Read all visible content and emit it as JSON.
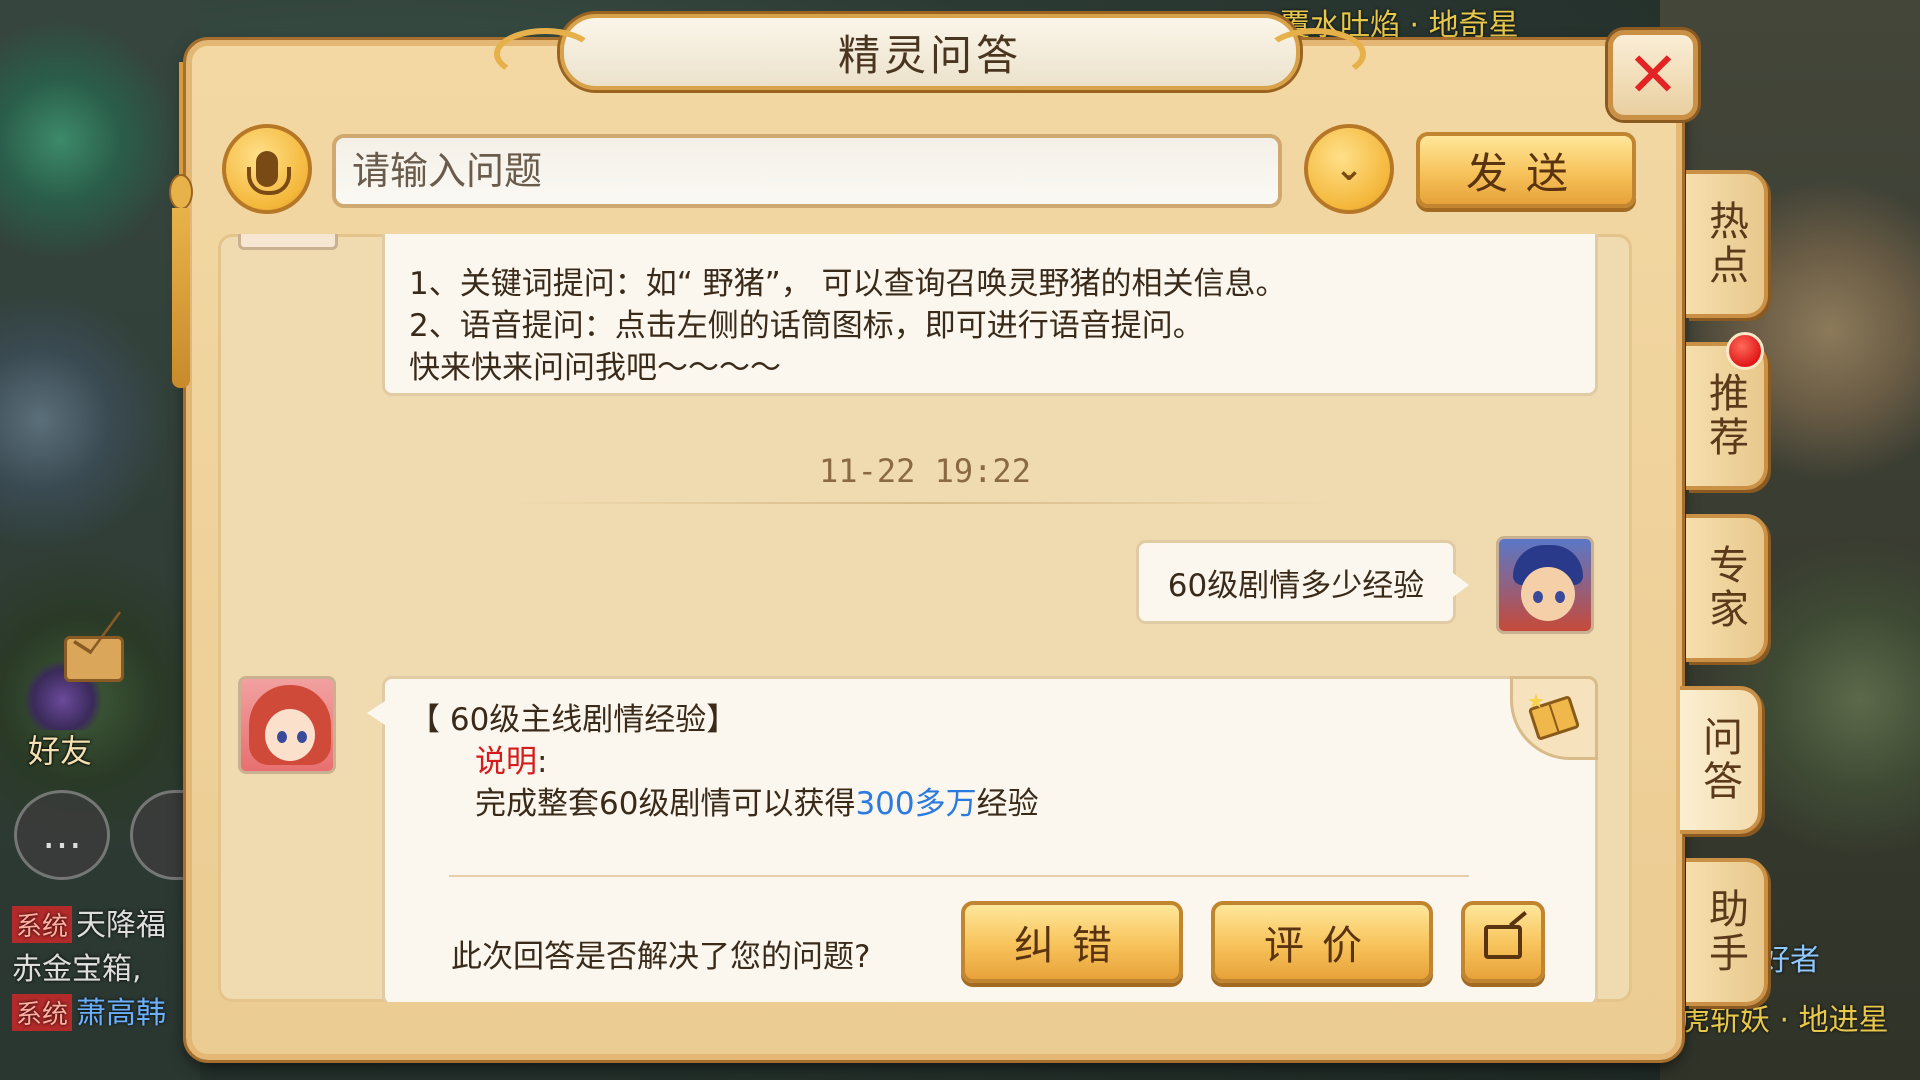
{
  "background": {
    "top_text": "覆水吐焰 · 地奇星",
    "bottom_right_text_1": "好者",
    "bottom_right_text_2": "虎斩妖 · 地进星",
    "friend_label": "好友",
    "system_lines": [
      {
        "tag": "系统",
        "text": "天降福"
      },
      {
        "tag": "",
        "text": "赤金宝箱,"
      },
      {
        "tag": "系统",
        "text": "萧高韩"
      }
    ]
  },
  "dialog": {
    "title": "精灵问答",
    "close_label": "✕"
  },
  "input_row": {
    "placeholder": "请输入问题",
    "dropdown_glyph": "⌄",
    "send_label": "发送"
  },
  "side_tabs": [
    {
      "label": "热点",
      "active": false
    },
    {
      "label": "推荐",
      "active": false,
      "has_notification": true
    },
    {
      "label": "专家",
      "active": false
    },
    {
      "label": "问答",
      "active": true
    },
    {
      "label": "助手",
      "active": false
    }
  ],
  "chat": {
    "intro_lines": [
      "1、关键词提问：如“ 野猪”， 可以查询召唤灵野猪的相关信息。",
      "2、语音提问：点击左侧的话筒图标，即可进行语音提问。",
      "快来快来问问我吧～～～～"
    ],
    "timestamp": "11-22  19:22",
    "user_message": "60级剧情多少经验",
    "answer": {
      "title": "【 60级主线剧情经验】",
      "label": "说明",
      "label_colon": ":",
      "body_prefix": "完成整套60级剧情可以获得",
      "body_highlight": "300多万",
      "body_suffix": "经验",
      "feedback_question": "此次回答是否解决了您的问题?",
      "correct_label": "纠错",
      "rate_label": "评价"
    }
  },
  "colors": {
    "accent_gold": "#f7c25a",
    "close_red": "#e42424",
    "highlight_blue": "#2a7ae0",
    "label_red": "#d41c1c"
  },
  "icons": {
    "mic": "microphone-icon",
    "dropdown": "chevron-down-icon",
    "close": "close-icon",
    "book": "book-icon",
    "share": "share-icon"
  }
}
